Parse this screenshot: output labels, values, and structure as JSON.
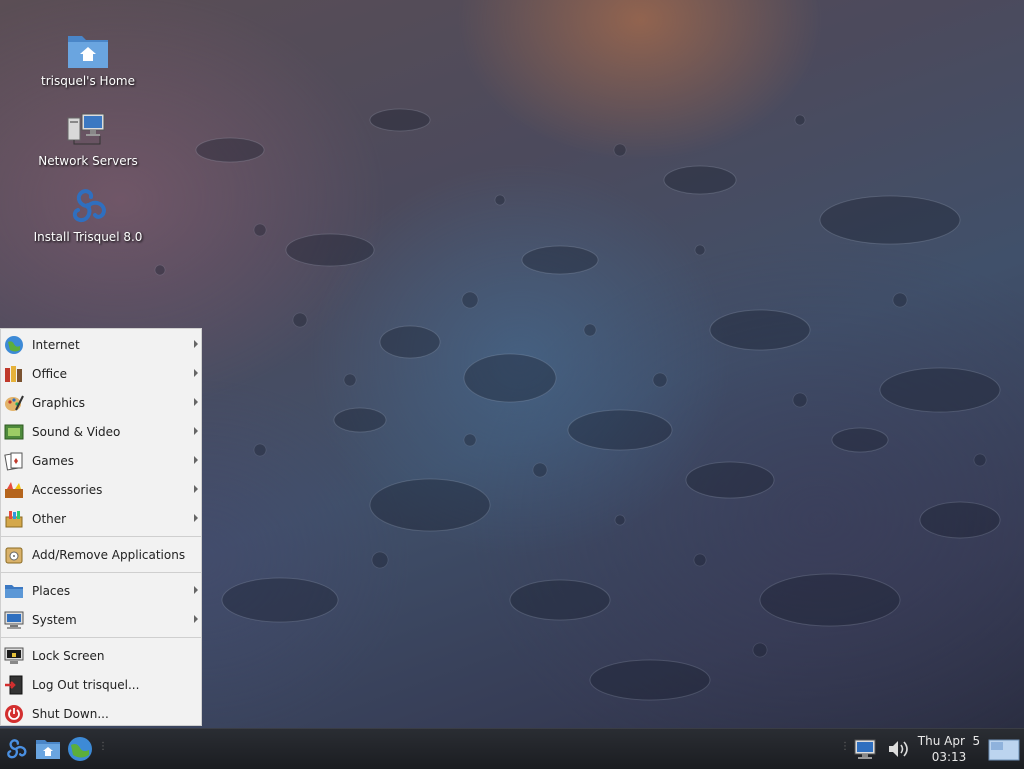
{
  "desktop": {
    "icons": [
      {
        "label": "trisquel's Home",
        "icon": "home-folder-icon"
      },
      {
        "label": "Network Servers",
        "icon": "network-servers-icon"
      },
      {
        "label": "Install Trisquel 8.0",
        "icon": "trisquel-logo-icon"
      }
    ]
  },
  "menu": {
    "items": [
      {
        "label": "Internet",
        "icon": "globe-icon",
        "submenu": true
      },
      {
        "label": "Office",
        "icon": "office-icon",
        "submenu": true
      },
      {
        "label": "Graphics",
        "icon": "graphics-icon",
        "submenu": true
      },
      {
        "label": "Sound & Video",
        "icon": "multimedia-icon",
        "submenu": true
      },
      {
        "label": "Games",
        "icon": "games-icon",
        "submenu": true
      },
      {
        "label": "Accessories",
        "icon": "accessories-icon",
        "submenu": true
      },
      {
        "label": "Other",
        "icon": "other-icon",
        "submenu": true
      },
      {
        "label": "Add/Remove Applications",
        "icon": "software-icon",
        "submenu": false
      },
      {
        "label": "Places",
        "icon": "folder-icon",
        "submenu": true
      },
      {
        "label": "System",
        "icon": "system-icon",
        "submenu": true
      },
      {
        "label": "Lock Screen",
        "icon": "lock-screen-icon",
        "submenu": false
      },
      {
        "label": "Log Out trisquel...",
        "icon": "logout-icon",
        "submenu": false
      },
      {
        "label": "Shut Down...",
        "icon": "power-icon",
        "submenu": false
      }
    ]
  },
  "taskbar": {
    "launchers": [
      "trisquel-menu-icon",
      "home-folder-icon",
      "web-browser-icon"
    ],
    "tray": [
      "network-icon",
      "volume-icon"
    ],
    "clock": {
      "day": "Thu Apr  5",
      "time": "03:13"
    },
    "desktop_button": "show-desktop-icon"
  },
  "colors": {
    "menu_bg": "#f2f2f2",
    "taskbar_bg": "#1b1d21",
    "accent": "#2f6fbf"
  }
}
